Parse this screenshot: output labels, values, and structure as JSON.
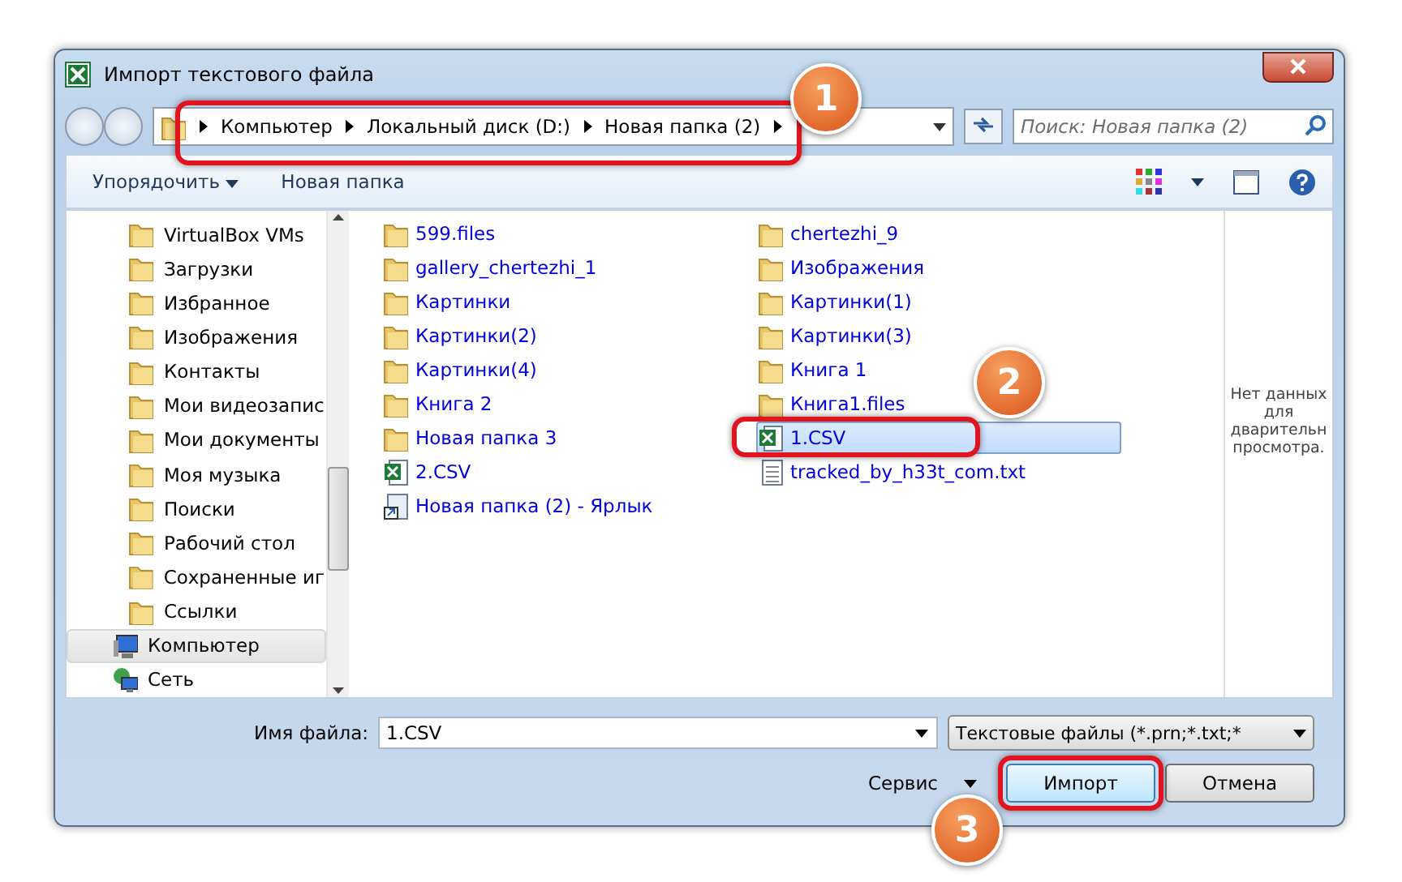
{
  "window": {
    "title": "Импорт текстового файла"
  },
  "address": {
    "crumbs": [
      "Компьютер",
      "Локальный диск (D:)",
      "Новая папка (2)"
    ]
  },
  "search": {
    "placeholder": "Поиск: Новая папка (2)"
  },
  "toolbar": {
    "organize": "Упорядочить",
    "new_folder": "Новая папка"
  },
  "nav": [
    {
      "label": "VirtualBox VMs",
      "kind": "folder",
      "selected": false
    },
    {
      "label": "Загрузки",
      "kind": "folder",
      "selected": false
    },
    {
      "label": "Избранное",
      "kind": "folder",
      "selected": false
    },
    {
      "label": "Изображения",
      "kind": "folder",
      "selected": false
    },
    {
      "label": "Контакты",
      "kind": "folder",
      "selected": false
    },
    {
      "label": "Мои видеозапис",
      "kind": "folder",
      "selected": false
    },
    {
      "label": "Мои документы",
      "kind": "folder",
      "selected": false
    },
    {
      "label": "Моя музыка",
      "kind": "folder",
      "selected": false
    },
    {
      "label": "Поиски",
      "kind": "folder",
      "selected": false
    },
    {
      "label": "Рабочий стол",
      "kind": "folder",
      "selected": false
    },
    {
      "label": "Сохраненные иг",
      "kind": "folder",
      "selected": false
    },
    {
      "label": "Ссылки",
      "kind": "folder",
      "selected": false
    },
    {
      "label": "Компьютер",
      "kind": "computer",
      "selected": true
    },
    {
      "label": "Сеть",
      "kind": "network",
      "selected": false
    }
  ],
  "files": [
    {
      "name": "599.files",
      "kind": "folder",
      "selected": false
    },
    {
      "name": "gallery_chertezhi_1",
      "kind": "folder",
      "selected": false
    },
    {
      "name": "Картинки",
      "kind": "folder",
      "selected": false
    },
    {
      "name": "Картинки(2)",
      "kind": "folder",
      "selected": false
    },
    {
      "name": "Картинки(4)",
      "kind": "folder",
      "selected": false
    },
    {
      "name": "Книга 2",
      "kind": "folder",
      "selected": false
    },
    {
      "name": "Новая папка 3",
      "kind": "folder",
      "selected": false
    },
    {
      "name": "2.CSV",
      "kind": "excel",
      "selected": false
    },
    {
      "name": "Новая папка (2) - Ярлык",
      "kind": "shortcut",
      "selected": false
    },
    {
      "name": "chertezhi_9",
      "kind": "folder",
      "selected": false
    },
    {
      "name": "Изображения",
      "kind": "folder",
      "selected": false
    },
    {
      "name": "Картинки(1)",
      "kind": "folder",
      "selected": false
    },
    {
      "name": "Картинки(3)",
      "kind": "folder",
      "selected": false
    },
    {
      "name": "Книга 1",
      "kind": "folder",
      "selected": false
    },
    {
      "name": "Книга1.files",
      "kind": "folder",
      "selected": false
    },
    {
      "name": "1.CSV",
      "kind": "excel",
      "selected": true
    },
    {
      "name": "tracked_by_h33t_com.txt",
      "kind": "text",
      "selected": false
    }
  ],
  "preview": {
    "message": "Нет данных для дварительн просмотра."
  },
  "filename": {
    "label": "Имя файла:",
    "value": "1.CSV"
  },
  "filetype": {
    "value": "Текстовые файлы (*.prn;*.txt;*"
  },
  "tools": {
    "label": "Сервис"
  },
  "buttons": [
    {
      "label": "Импорт",
      "kind": "primary"
    },
    {
      "label": "Отмена",
      "kind": "normal"
    }
  ],
  "callouts": [
    "1",
    "2",
    "3"
  ]
}
